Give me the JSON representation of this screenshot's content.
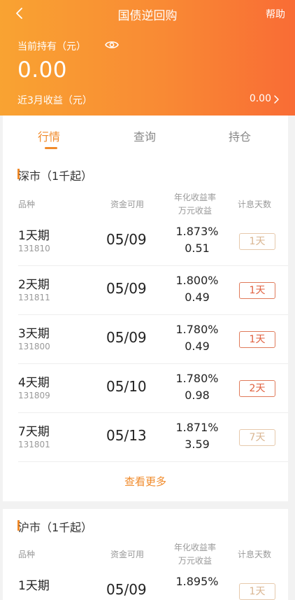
{
  "header": {
    "title": "国债逆回购",
    "help": "帮助",
    "hold_label": "当前持有（元）",
    "hold_value": "0.00",
    "income_label": "近3月收益（元）",
    "income_value": "0.00"
  },
  "tabs": [
    {
      "label": "行情",
      "active": true
    },
    {
      "label": "查询",
      "active": false
    },
    {
      "label": "持仓",
      "active": false
    }
  ],
  "columns": {
    "product": "品种",
    "funds_available": "资金可用",
    "annual_rate": "年化收益率",
    "per_10k": "万元收益",
    "interest_days": "计息天数"
  },
  "shenzhen": {
    "title": "深市（1千起）",
    "rows": [
      {
        "name": "1天期",
        "code": "131810",
        "date": "05/09",
        "rate": "1.873%",
        "earn": "0.51",
        "days": "1天",
        "strong": false
      },
      {
        "name": "2天期",
        "code": "131811",
        "date": "05/09",
        "rate": "1.800%",
        "earn": "0.49",
        "days": "1天",
        "strong": true
      },
      {
        "name": "3天期",
        "code": "131800",
        "date": "05/09",
        "rate": "1.780%",
        "earn": "0.49",
        "days": "1天",
        "strong": true
      },
      {
        "name": "4天期",
        "code": "131809",
        "date": "05/10",
        "rate": "1.780%",
        "earn": "0.98",
        "days": "2天",
        "strong": true
      },
      {
        "name": "7天期",
        "code": "131801",
        "date": "05/13",
        "rate": "1.871%",
        "earn": "3.59",
        "days": "7天",
        "strong": false
      }
    ],
    "more": "查看更多"
  },
  "shanghai": {
    "title": "沪市（1千起）",
    "rows": [
      {
        "name": "1天期",
        "date": "05/09",
        "rate": "1.895%",
        "days": "1天",
        "strong": false
      }
    ]
  },
  "colors": {
    "accent": "#f08a2a",
    "header_start": "#f9a332",
    "header_end": "#f96c35",
    "badge_strong": "#e0603f",
    "badge_light": "#d9b591"
  },
  "icons": {
    "back": "chevron-left-icon",
    "eye": "eye-icon",
    "income_arrow": "chevron-right-icon"
  }
}
